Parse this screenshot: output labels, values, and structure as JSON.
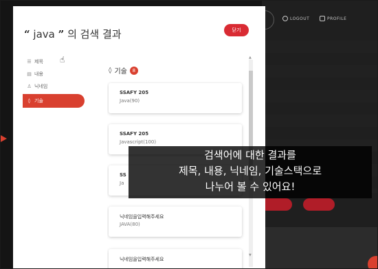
{
  "modal": {
    "title_keyword": "java",
    "title_open_quote": "“",
    "title_close_quote": "”",
    "title_suffix": "의 검색 결과",
    "close_label": "닫기"
  },
  "sidebar": {
    "items": [
      {
        "label": "제목",
        "icon": "list-icon"
      },
      {
        "label": "내용",
        "icon": "document-icon"
      },
      {
        "label": "닉네임",
        "icon": "person-icon"
      },
      {
        "label": "기술",
        "icon": "code-icon"
      }
    ],
    "active_index": 3
  },
  "section": {
    "label": "기술",
    "count": "8"
  },
  "results": [
    {
      "title": "SSAFY 205",
      "subtitle": "Java(90)"
    },
    {
      "title": "SSAFY 205",
      "subtitle": "Javascript(100)"
    },
    {
      "title": "SS",
      "subtitle": "Ja"
    },
    {
      "title": "닉네임을입력해주세요",
      "subtitle": "JAVA(80)"
    },
    {
      "title": "닉네임을입력해주세요",
      "subtitle": ""
    }
  ],
  "background_app": {
    "nav": {
      "logout": "LOGOUT",
      "profile": "PROFILE"
    },
    "buttons": [
      "",
      ""
    ]
  },
  "caption": {
    "lines": [
      "검색어에 대한 결과를",
      "제목, 내용, 닉네임, 기술스택으로",
      "나누어 볼 수 있어요!"
    ]
  },
  "colors": {
    "accent": "#d9402f",
    "close_button": "#d92b33",
    "background_dark": "#1f1f1f"
  }
}
